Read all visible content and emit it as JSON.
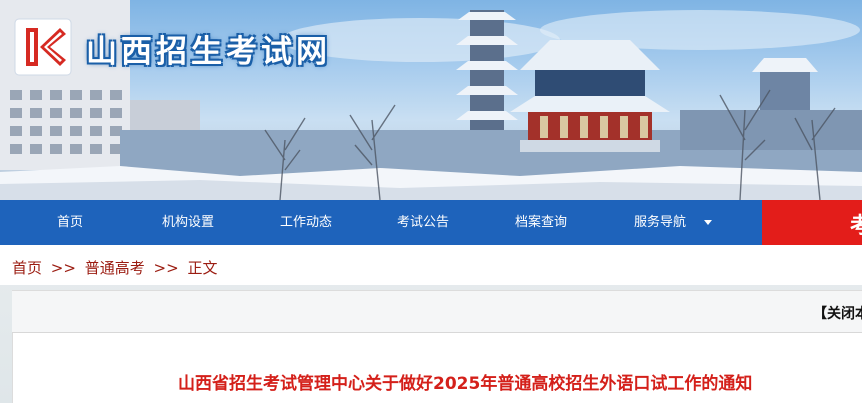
{
  "site": {
    "title": "山西招生考试网",
    "logo_icon": "k-logo-icon"
  },
  "nav": {
    "items": [
      {
        "label": "首页"
      },
      {
        "label": "机构设置"
      },
      {
        "label": "工作动态"
      },
      {
        "label": "考试公告"
      },
      {
        "label": "档案查询"
      },
      {
        "label": "服务导航"
      }
    ],
    "dropdown_icon": "caret-down-icon",
    "search_button_text": "考",
    "bar_color": "#1e63bb",
    "accent_color": "#e31d1a"
  },
  "breadcrumb": {
    "items": [
      "首页",
      "普通高考",
      "正文"
    ],
    "separator": ">>"
  },
  "article": {
    "close_link": "【关闭本",
    "title": "山西省招生考试管理中心关于做好2025年普通高校招生外语口试工作的通知",
    "title_color": "#d4201a"
  }
}
